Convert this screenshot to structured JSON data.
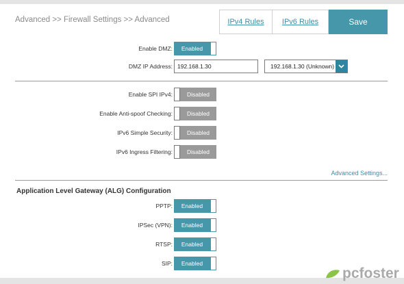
{
  "header": {
    "breadcrumb": "Advanced >> Firewall Settings >> Advanced",
    "ipv4_rules_label": "IPv4 Rules",
    "ipv6_rules_label": "IPv6 Rules",
    "save_label": "Save"
  },
  "dmz": {
    "enable_label": "Enable DMZ:",
    "enable_state": "Enabled",
    "ip_label": "DMZ IP Address:",
    "ip_value": "192.168.1.30",
    "ip_select": "192.168.1.30 (Unknown)"
  },
  "security": {
    "spi_label": "Enable SPI IPv4:",
    "spi_state": "Disabled",
    "antispoof_label": "Enable Anti-spoof Checking:",
    "antispoof_state": "Disabled",
    "ipv6_simple_label": "IPv6 Simple Security:",
    "ipv6_simple_state": "Disabled",
    "ipv6_ingress_label": "IPv6 Ingress Filtering:",
    "ipv6_ingress_state": "Disabled",
    "advanced_link": "Advanced Settings..."
  },
  "alg": {
    "title": "Application Level Gateway (ALG) Configuration",
    "pptp_label": "PPTP:",
    "pptp_state": "Enabled",
    "ipsec_label": "IPSec (VPN):",
    "ipsec_state": "Enabled",
    "rtsp_label": "RTSP:",
    "rtsp_state": "Enabled",
    "sip_label": "SIP:",
    "sip_state": "Enabled"
  },
  "watermark": {
    "text": "pcfoster"
  },
  "colors": {
    "accent": "#4797ab",
    "disabled": "#9a9a9a",
    "link": "#3b8fa6"
  }
}
